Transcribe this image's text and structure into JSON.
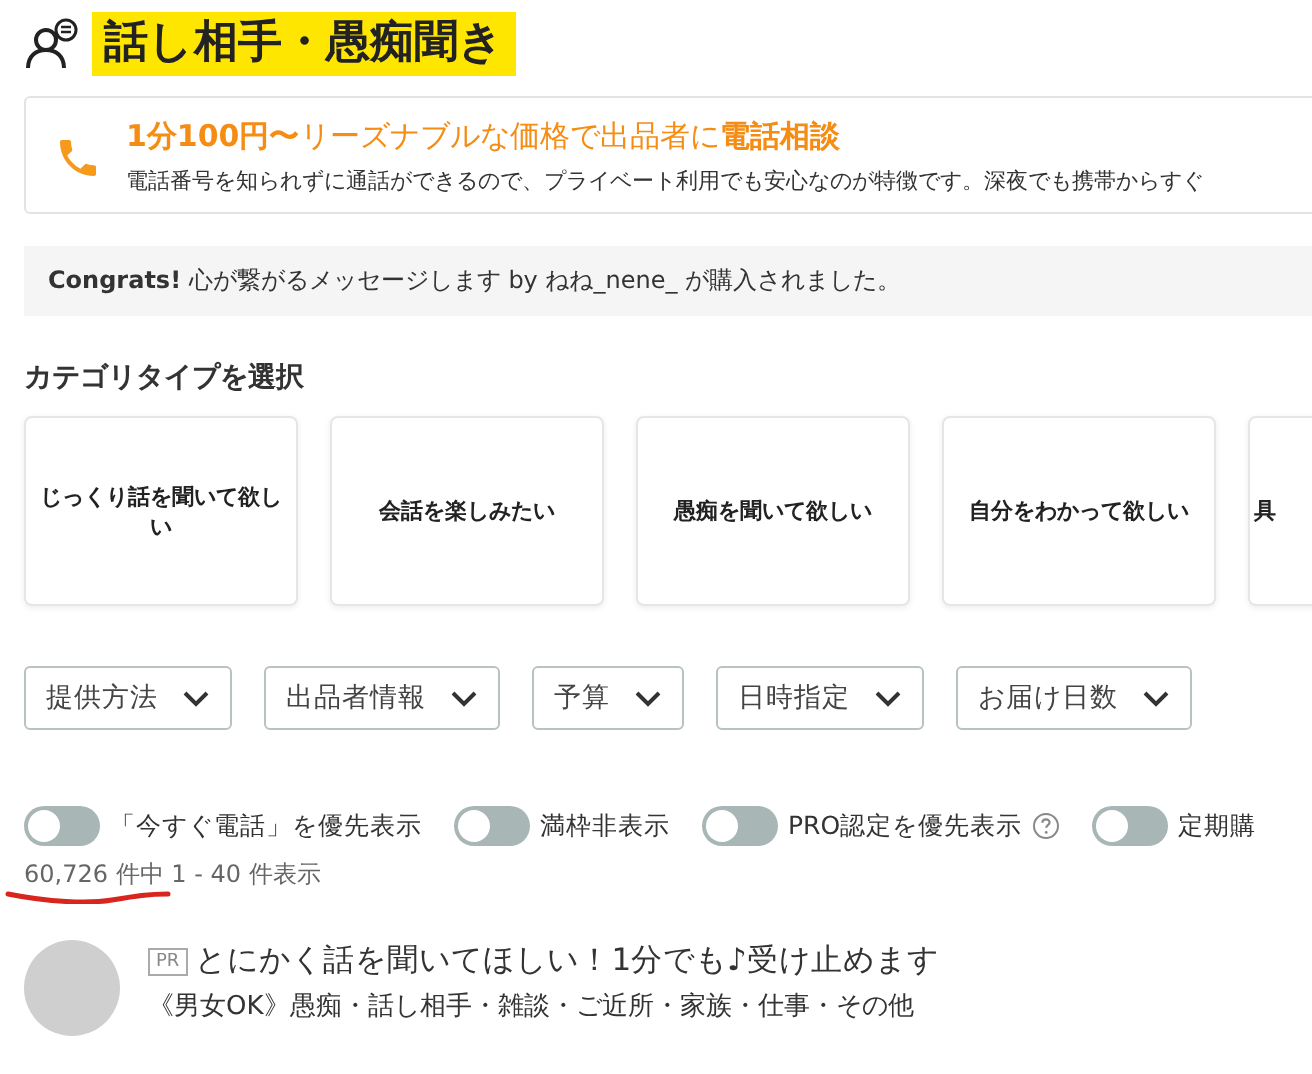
{
  "page_title": "話し相手・愚痴聞き",
  "banner": {
    "headline": "**1分100円〜**リーズナブルな価格で出品者に**電話相談**",
    "description": "電話番号を知られずに通話ができるので、プライベート利用でも安心なのが特徴です。深夜でも携帯からすぐ"
  },
  "notice": "**Congrats!** 心が繋がるメッセージします by ねね_nene_ が購入されました。",
  "category_heading": "カテゴリタイプを選択",
  "categories": [
    "じっくり話を聞いて欲しい",
    "会話を楽しみたい",
    "愚痴を聞いて欲しい",
    "自分をわかって欲しい",
    "具"
  ],
  "filters": [
    "提供方法",
    "出品者情報",
    "予算",
    "日時指定",
    "お届け日数"
  ],
  "toggles": [
    {
      "kind": "plain",
      "label": "「今すぐ電話」を優先表示",
      "checked": false
    },
    {
      "kind": "plain",
      "label": "満枠非表示",
      "checked": false
    },
    {
      "kind": "help",
      "label": "PRO認定を優先表示",
      "checked": false
    },
    {
      "kind": "plain",
      "label": "定期購",
      "checked": false
    }
  ],
  "result_count": "60,726 件中 1 - 40 件表示",
  "listings": [
    {
      "badge": "PR",
      "title": "とにかく話を聞いてほしい！1分でも♪受け止めます",
      "subtitle": "《男女OK》愚痴・話し相手・雑談・ご近所・家族・仕事・その他"
    }
  ]
}
